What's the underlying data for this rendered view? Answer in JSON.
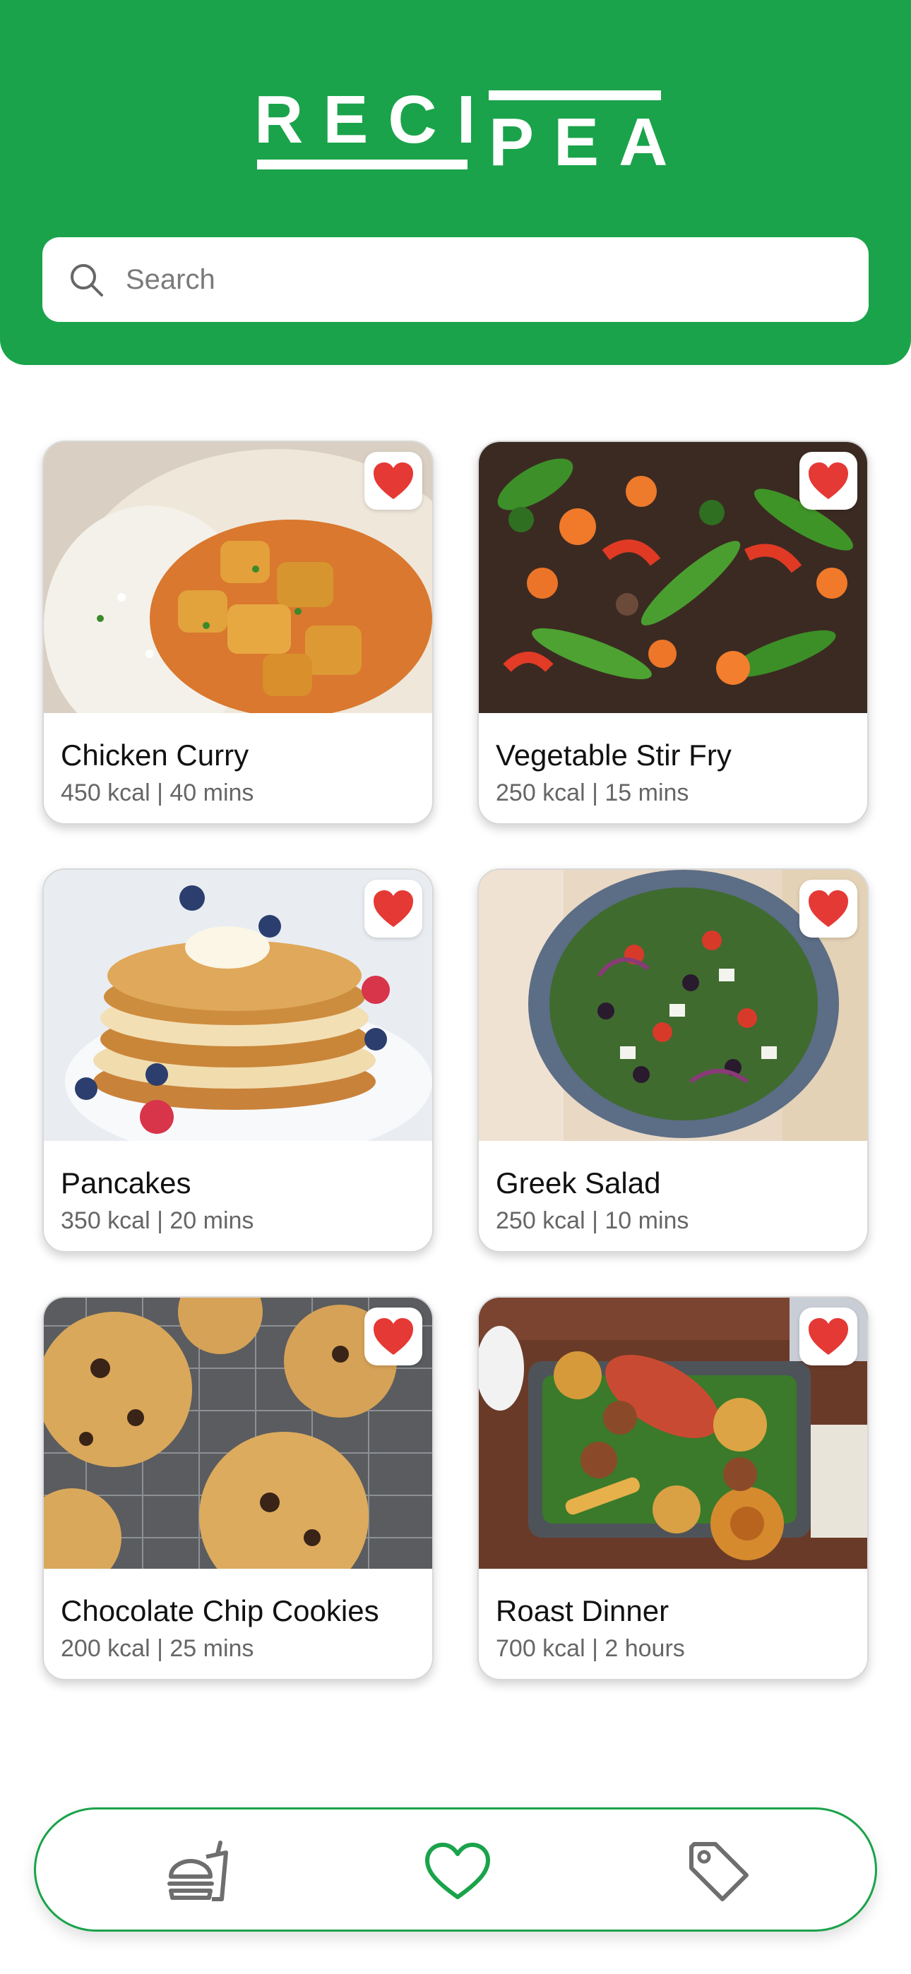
{
  "app": {
    "logo_top": "RECI",
    "logo_bottom": "PEA"
  },
  "search": {
    "placeholder": "Search",
    "value": ""
  },
  "recipes": [
    {
      "title": "Chicken Curry",
      "meta": "450 kcal | 40 mins",
      "favorite": true
    },
    {
      "title": "Vegetable Stir Fry",
      "meta": "250 kcal | 15 mins",
      "favorite": true
    },
    {
      "title": "Pancakes",
      "meta": "350 kcal | 20 mins",
      "favorite": true
    },
    {
      "title": "Greek Salad",
      "meta": "250 kcal | 10 mins",
      "favorite": true
    },
    {
      "title": "Chocolate Chip Cookies",
      "meta": "200 kcal | 25 mins",
      "favorite": true
    },
    {
      "title": "Roast Dinner",
      "meta": "700 kcal | 2 hours",
      "favorite": true
    }
  ],
  "nav": {
    "items": [
      {
        "icon": "food-icon"
      },
      {
        "icon": "heart-icon",
        "active": true
      },
      {
        "icon": "tag-icon"
      }
    ]
  },
  "colors": {
    "brand": "#1aa34a",
    "favorite": "#e53935"
  }
}
